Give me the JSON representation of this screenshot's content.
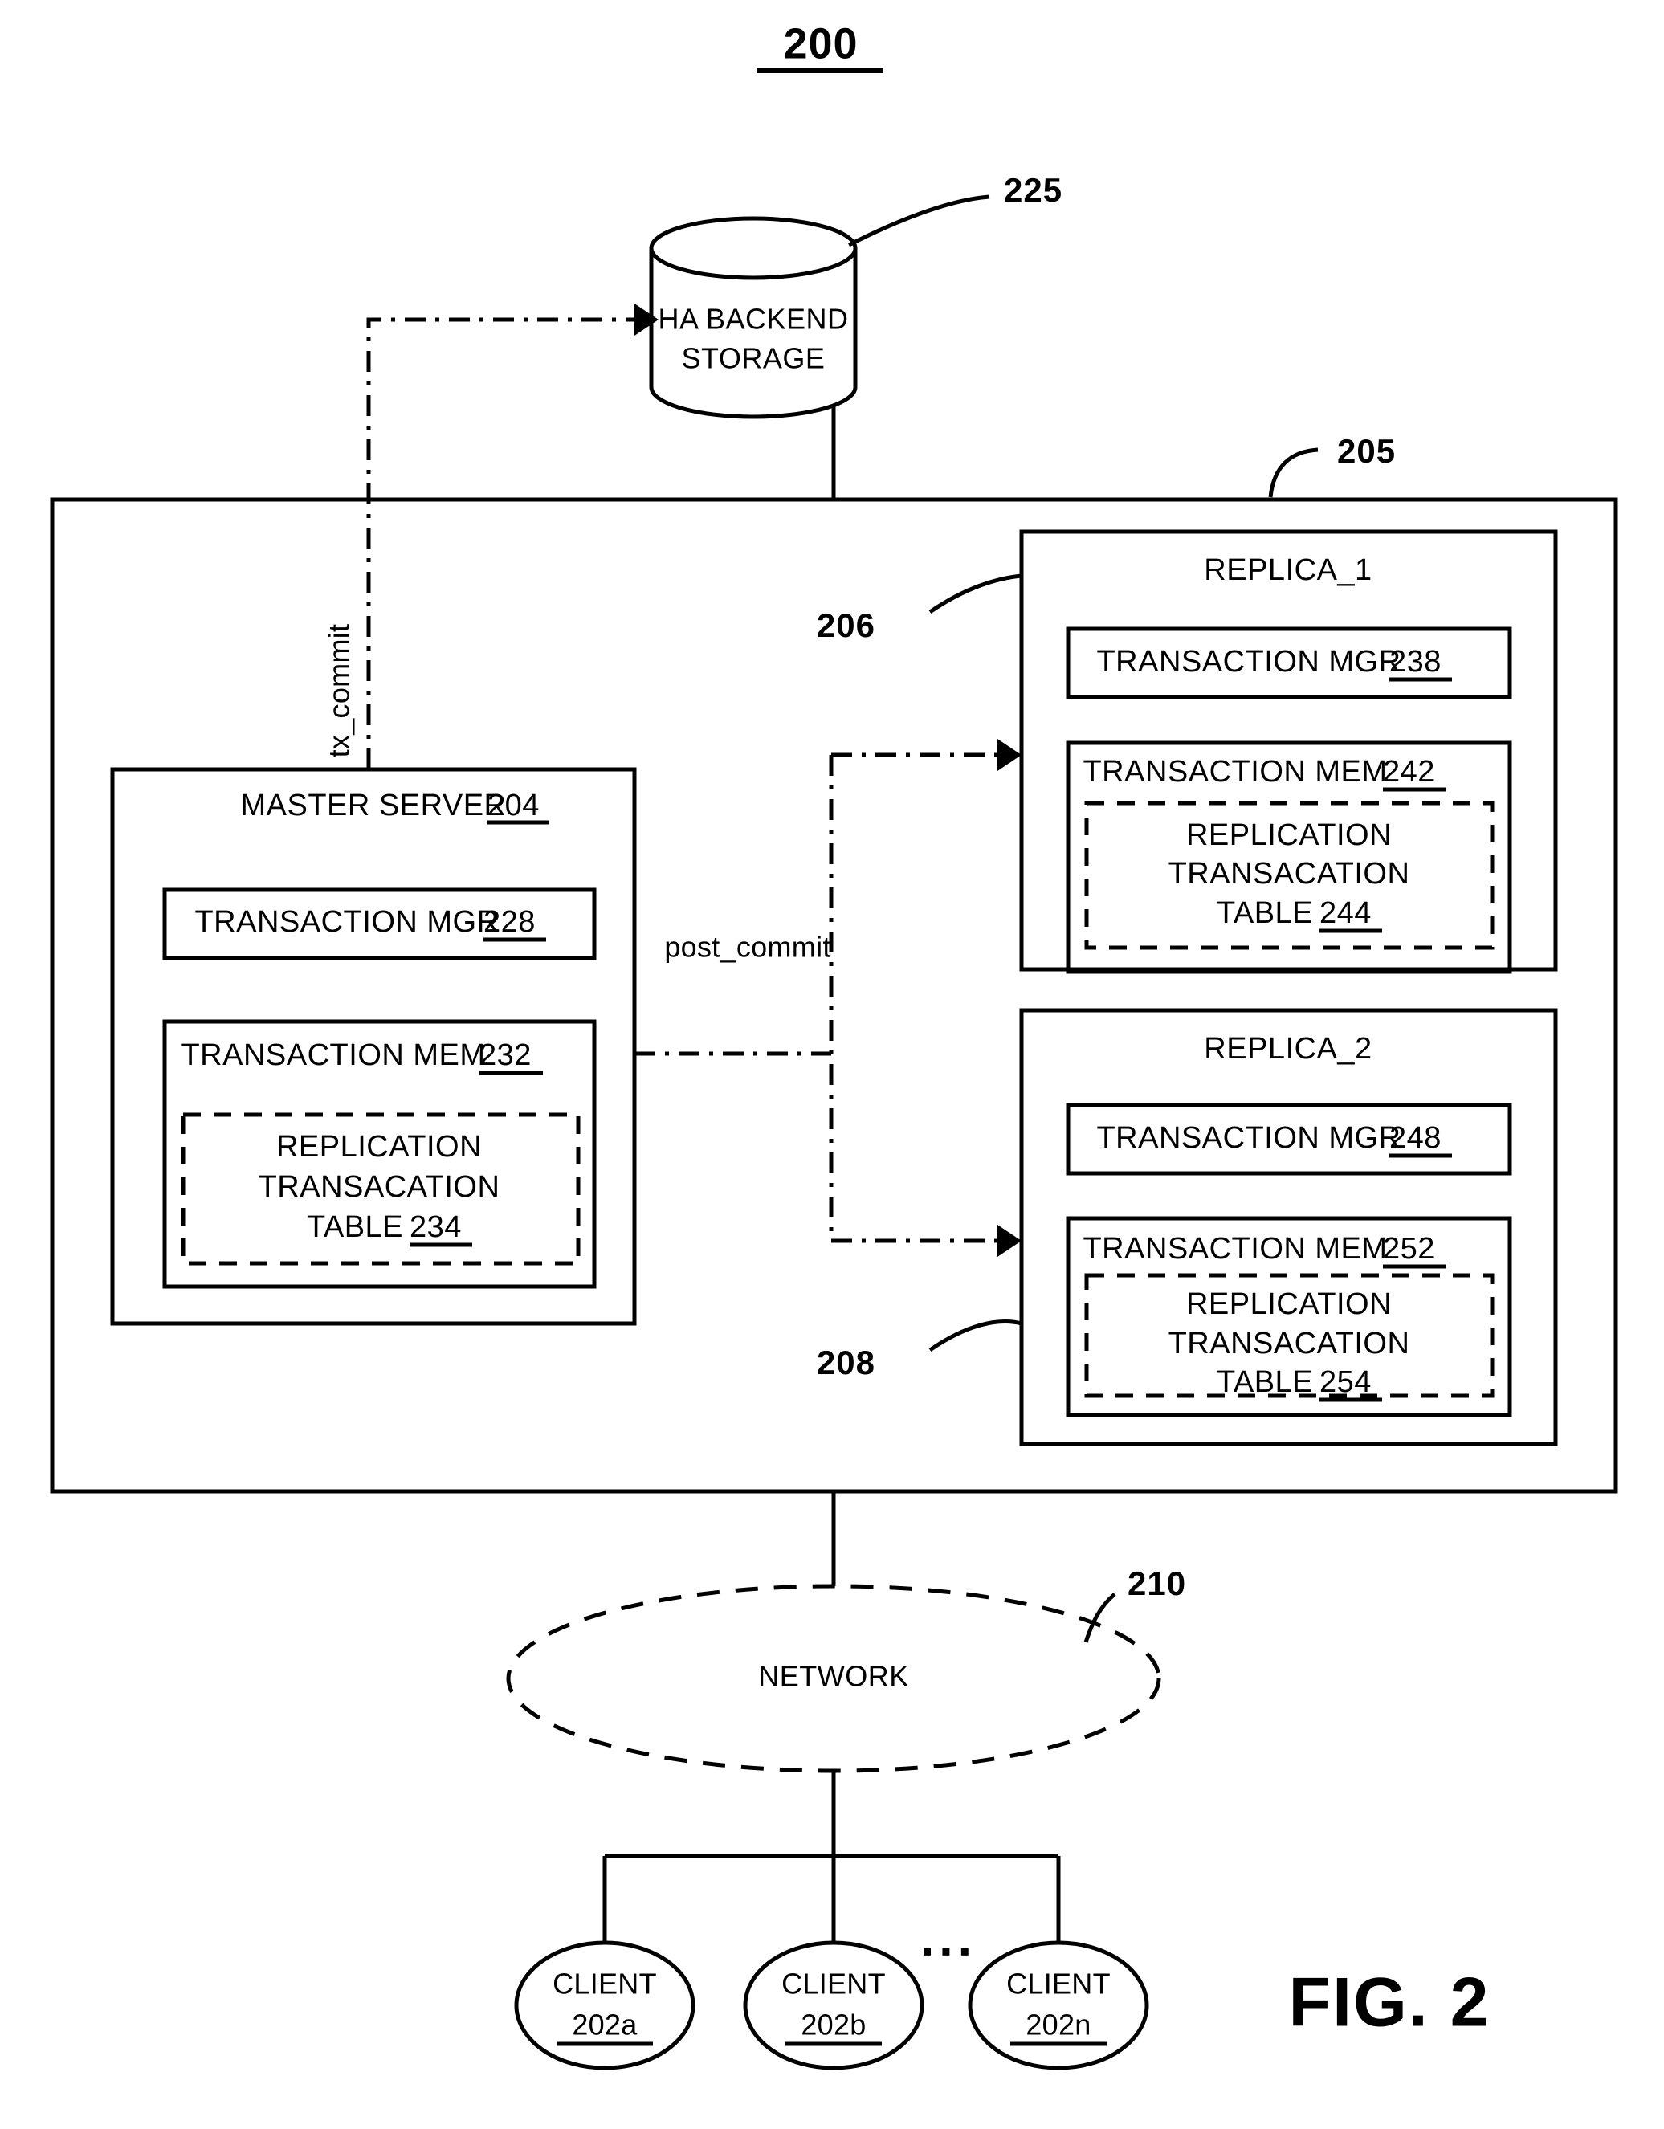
{
  "figure": {
    "number_top": "200",
    "caption": "FIG. 2"
  },
  "storage": {
    "label_line1": "HA BACKEND",
    "label_line2": "STORAGE",
    "ref": "225"
  },
  "system": {
    "ref": "205"
  },
  "master_server": {
    "title": "MASTER SERVER",
    "ref": "204",
    "transaction_mgr": {
      "label": "TRANSACTION MGR",
      "ref": "228"
    },
    "transaction_mem": {
      "label": "TRANSACTION MEM",
      "ref": "232"
    },
    "replication_table": {
      "line1": "REPLICATION",
      "line2": "TRANSACATION",
      "line3": "TABLE",
      "ref": "234"
    }
  },
  "replica_1": {
    "title": "REPLICA_1",
    "ref": "206",
    "transaction_mgr": {
      "label": "TRANSACTION MGR",
      "ref": "238"
    },
    "transaction_mem": {
      "label": "TRANSACTION MEM",
      "ref": "242"
    },
    "replication_table": {
      "line1": "REPLICATION",
      "line2": "TRANSACATION",
      "line3": "TABLE",
      "ref": "244"
    }
  },
  "replica_2": {
    "title": "REPLICA_2",
    "ref": "208",
    "transaction_mgr": {
      "label": "TRANSACTION MGR",
      "ref": "248"
    },
    "transaction_mem": {
      "label": "TRANSACTION MEM",
      "ref": "252"
    },
    "replication_table": {
      "line1": "REPLICATION",
      "line2": "TRANSACATION",
      "line3": "TABLE",
      "ref": "254"
    }
  },
  "flows": {
    "tx_commit": "tx_commit",
    "post_commit": "post_commit"
  },
  "network": {
    "label": "NETWORK",
    "ref": "210"
  },
  "clients": [
    {
      "label": "CLIENT",
      "ref": "202a"
    },
    {
      "label": "CLIENT",
      "ref": "202b"
    },
    {
      "label": "CLIENT",
      "ref": "202n"
    }
  ],
  "ellipsis": "▪ ▪ ▪"
}
